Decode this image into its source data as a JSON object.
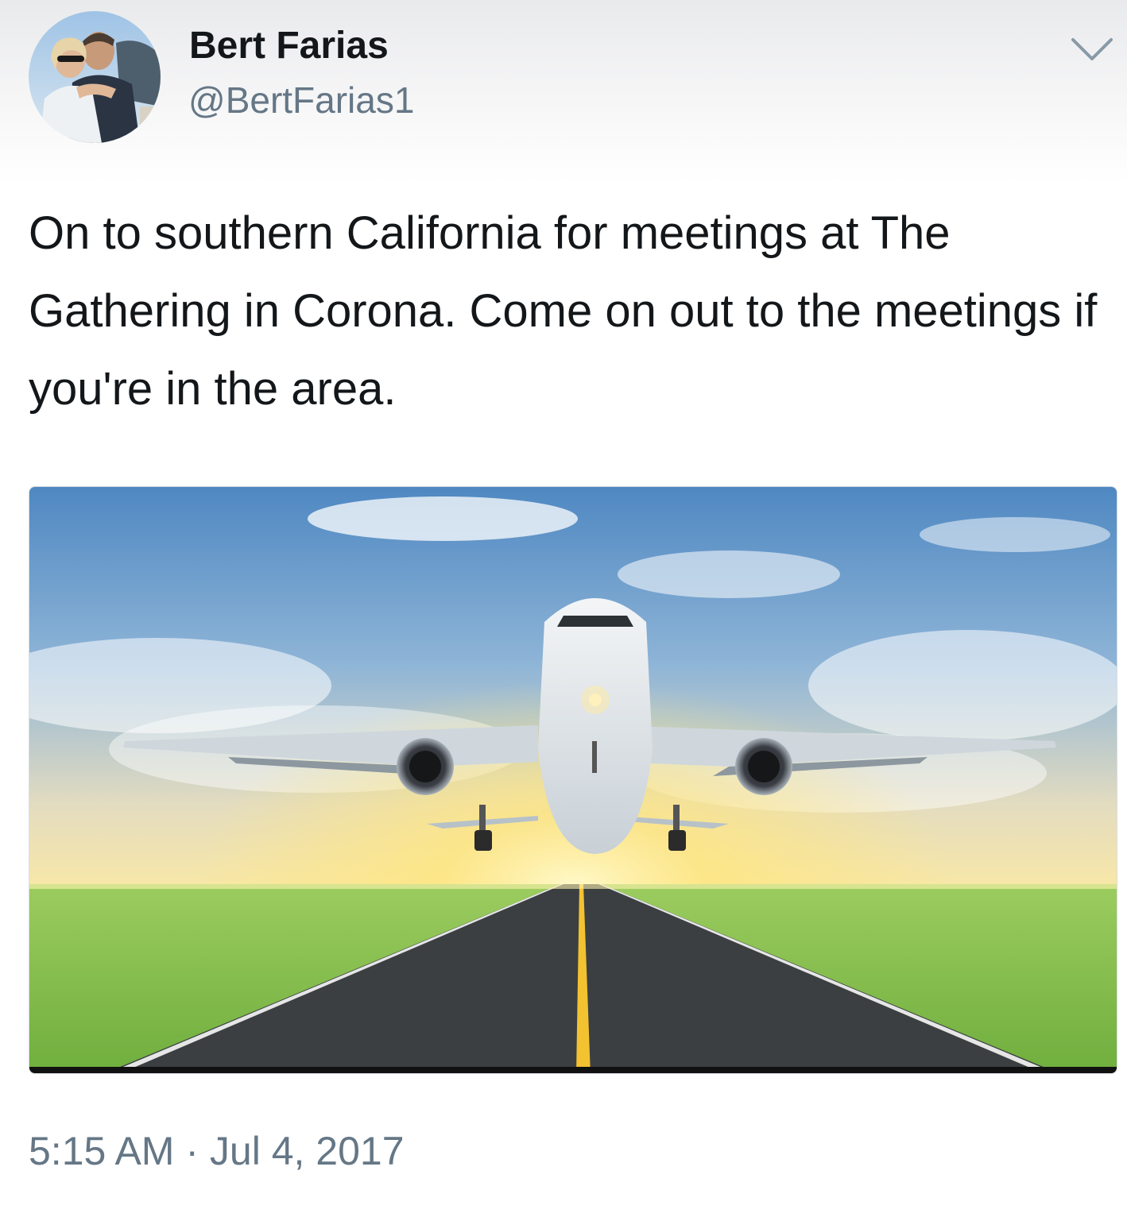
{
  "tweet": {
    "author": {
      "display_name": "Bert Farias",
      "handle": "@BertFarias1",
      "avatar_icon": "profile-photo"
    },
    "menu_icon": "chevron-down-icon",
    "text": "On to southern California for meetings at The Gathering in Corona. Come on out to the meetings if you're in the area.",
    "media_icon": "airplane-takeoff-photo",
    "timestamp": "5:15 AM · Jul 4, 2017"
  },
  "colors": {
    "text_primary": "#14171a",
    "text_secondary": "#657786",
    "sky": "#5f95c9",
    "grass": "#7cb747",
    "runway": "#3b3f42",
    "center_line": "#f2c230"
  }
}
